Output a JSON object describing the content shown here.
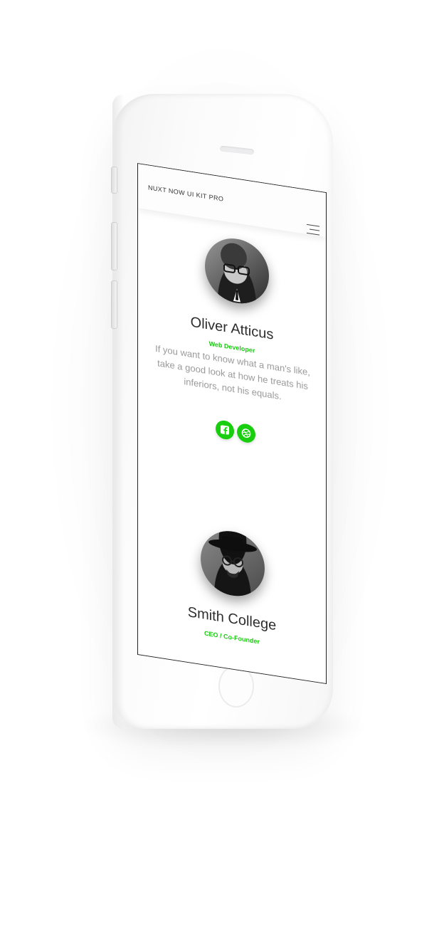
{
  "navbar": {
    "brand": "NUXT NOW UI KIT PRO",
    "menu_icon": "hamburger-menu-icon"
  },
  "team": [
    {
      "name": "Oliver Atticus",
      "role": "Web Developer",
      "quote": "If you want to know what a man's like, take a good look at how he treats his inferiors, not his equals.",
      "socials": [
        "facebook-icon",
        "dribbble-icon"
      ]
    },
    {
      "name": "Smith College",
      "role": "CEO / Co-Founder"
    }
  ],
  "colors": {
    "accent": "#18ce0f",
    "text": "#2c2c2c",
    "muted": "#9a9a9a"
  }
}
